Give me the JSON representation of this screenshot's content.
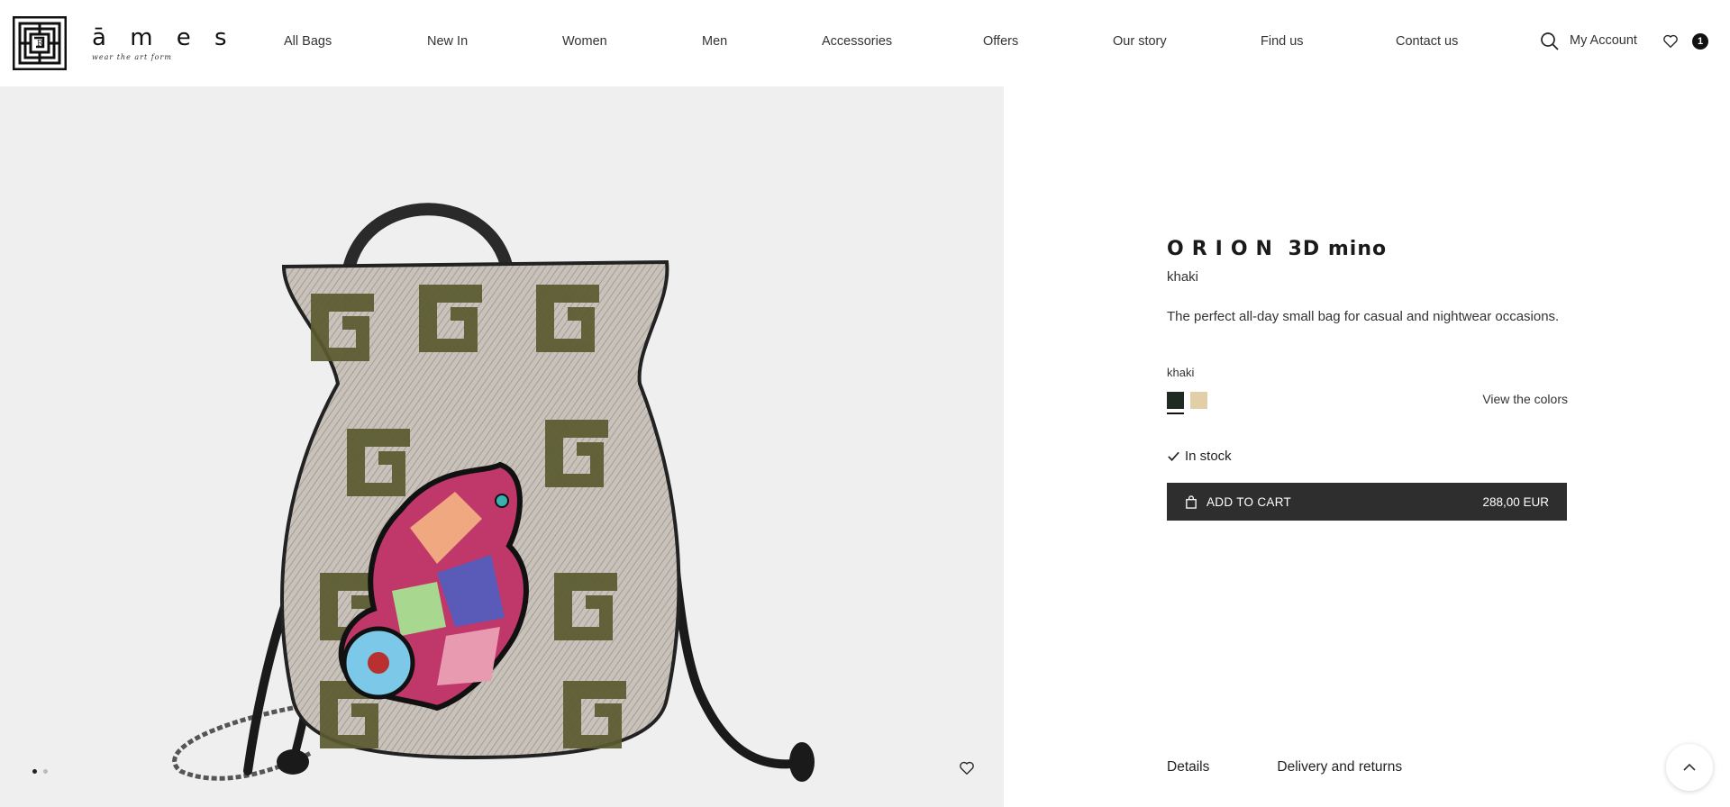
{
  "header": {
    "logo_word": "ā m e s",
    "logo_tagline": "wear the art form",
    "nav": [
      {
        "label": "All Bags"
      },
      {
        "label": "New In"
      },
      {
        "label": "Women"
      },
      {
        "label": "Men"
      },
      {
        "label": "Accessories"
      },
      {
        "label": "Offers"
      },
      {
        "label": "Our story"
      },
      {
        "label": "Find us"
      },
      {
        "label": "Contact us"
      }
    ],
    "search_icon": "search-icon",
    "account_label": "My Account",
    "wishlist_icon": "heart-icon",
    "cart_count": "1"
  },
  "gallery": {
    "slides_total": 2,
    "active_slide": 1,
    "wishlist_icon": "heart-icon"
  },
  "product": {
    "title_spaced": "ORION",
    "title_rest": "3D mino",
    "subtitle": "khaki",
    "description": "The perfect all-day small bag for casual and nightwear occasions.",
    "selected_color_label": "khaki",
    "swatches": [
      {
        "name": "khaki",
        "color": "#1f2a22",
        "selected": true
      },
      {
        "name": "beige",
        "color": "#e2cfa8",
        "selected": false
      }
    ],
    "view_colors": "View the colors",
    "stock": "In stock",
    "add_to_cart": "ADD TO CART",
    "price": "288,00 EUR",
    "tabs": [
      {
        "label": "Details"
      },
      {
        "label": "Delivery and returns"
      }
    ]
  },
  "back_to_top_icon": "chevron-up-icon"
}
